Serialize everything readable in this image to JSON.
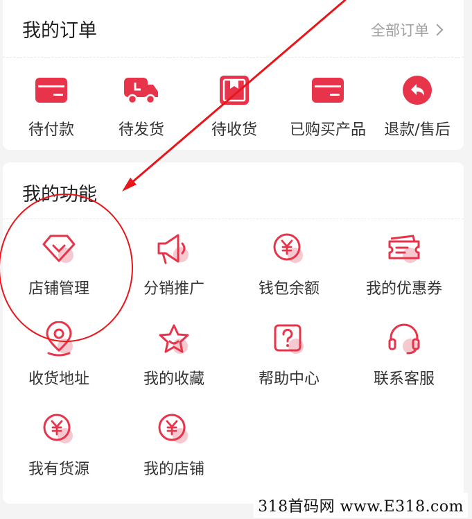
{
  "orders": {
    "title": "我的订单",
    "all_link": "全部订单",
    "items": [
      {
        "label": "待付款",
        "icon": "card-icon"
      },
      {
        "label": "待发货",
        "icon": "truck-icon"
      },
      {
        "label": "待收货",
        "icon": "box-icon"
      },
      {
        "label": "已购买产品",
        "icon": "card-icon"
      },
      {
        "label": "退款/售后",
        "icon": "return-icon"
      }
    ]
  },
  "functions": {
    "title": "我的功能",
    "items": [
      {
        "label": "店铺管理",
        "icon": "diamond-icon"
      },
      {
        "label": "分销推广",
        "icon": "megaphone-icon"
      },
      {
        "label": "钱包余额",
        "icon": "yen-icon"
      },
      {
        "label": "我的优惠券",
        "icon": "ticket-icon"
      },
      {
        "label": "收货地址",
        "icon": "location-icon"
      },
      {
        "label": "我的收藏",
        "icon": "star-icon"
      },
      {
        "label": "帮助中心",
        "icon": "help-icon"
      },
      {
        "label": "联系客服",
        "icon": "headset-icon"
      },
      {
        "label": "我有货源",
        "icon": "yen-icon"
      },
      {
        "label": "我的店铺",
        "icon": "yen-icon"
      }
    ]
  },
  "watermark": "318首码网 www.E318.com",
  "colors": {
    "accent": "#e8344a",
    "annotation": "#e8161b",
    "pink_shadow": "#f6c9d0"
  }
}
